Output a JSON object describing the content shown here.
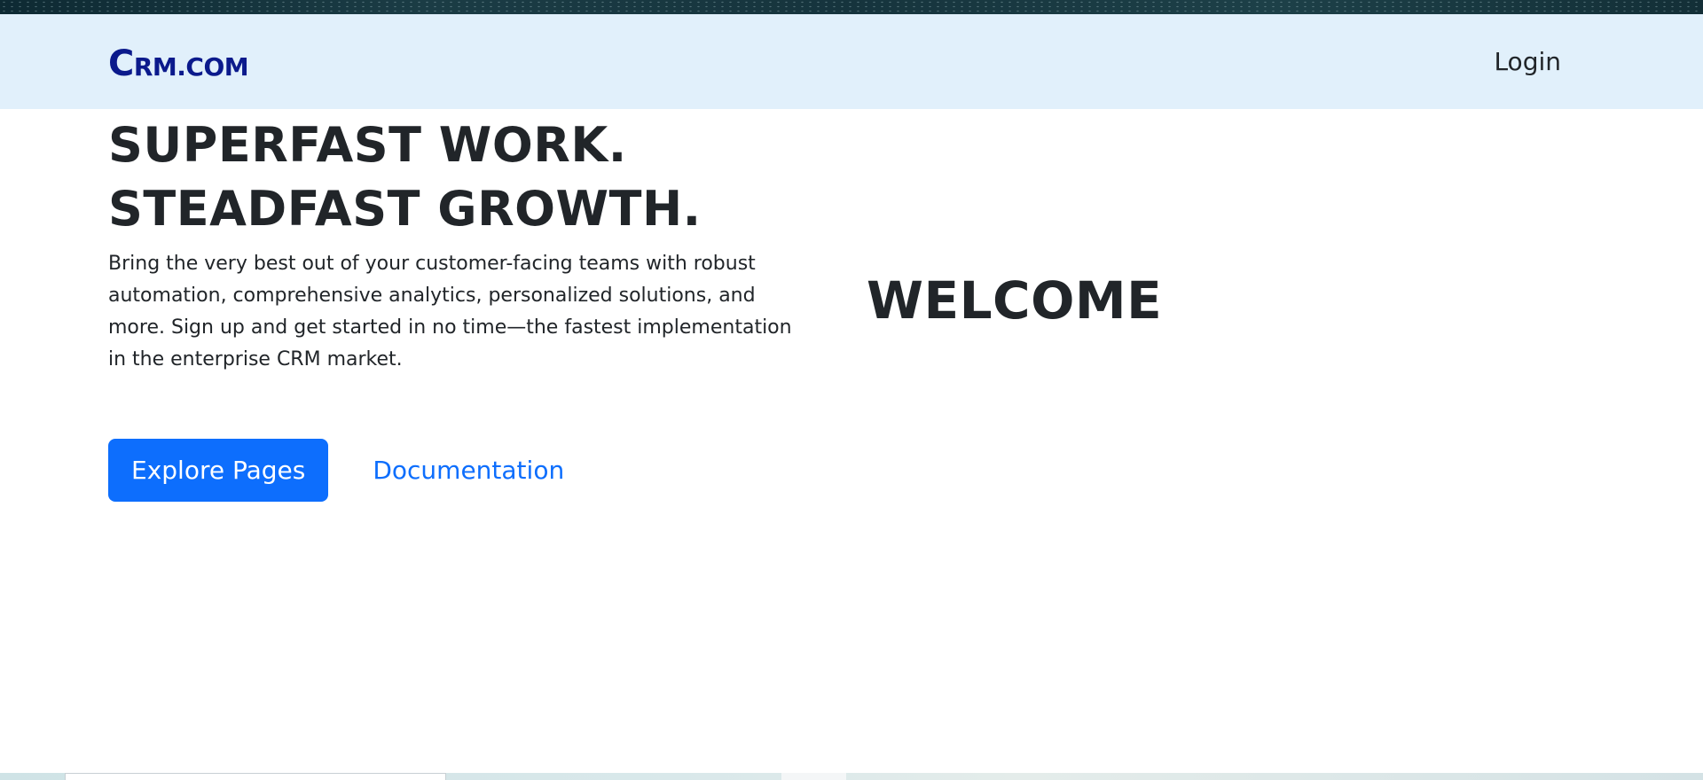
{
  "navbar": {
    "brand_initial": "C",
    "brand_rest": "RM.COM",
    "login_label": "Login",
    "brand_color": "#0b1a8c",
    "background": "#e1f0fb"
  },
  "hero": {
    "headline_line1": "SUPERFAST WORK.",
    "headline_line2": "STEADFAST GROWTH.",
    "lead": "Bring the very best out of your customer-facing teams with robust automation, comprehensive analytics, personalized solutions, and more. Sign up and get started in no time—the fastest implementation in the enterprise CRM market.",
    "primary_button_label": "Explore Pages",
    "secondary_link_label": "Documentation",
    "accent_color": "#0d6efd"
  },
  "welcome": {
    "title": "WELCOME"
  }
}
